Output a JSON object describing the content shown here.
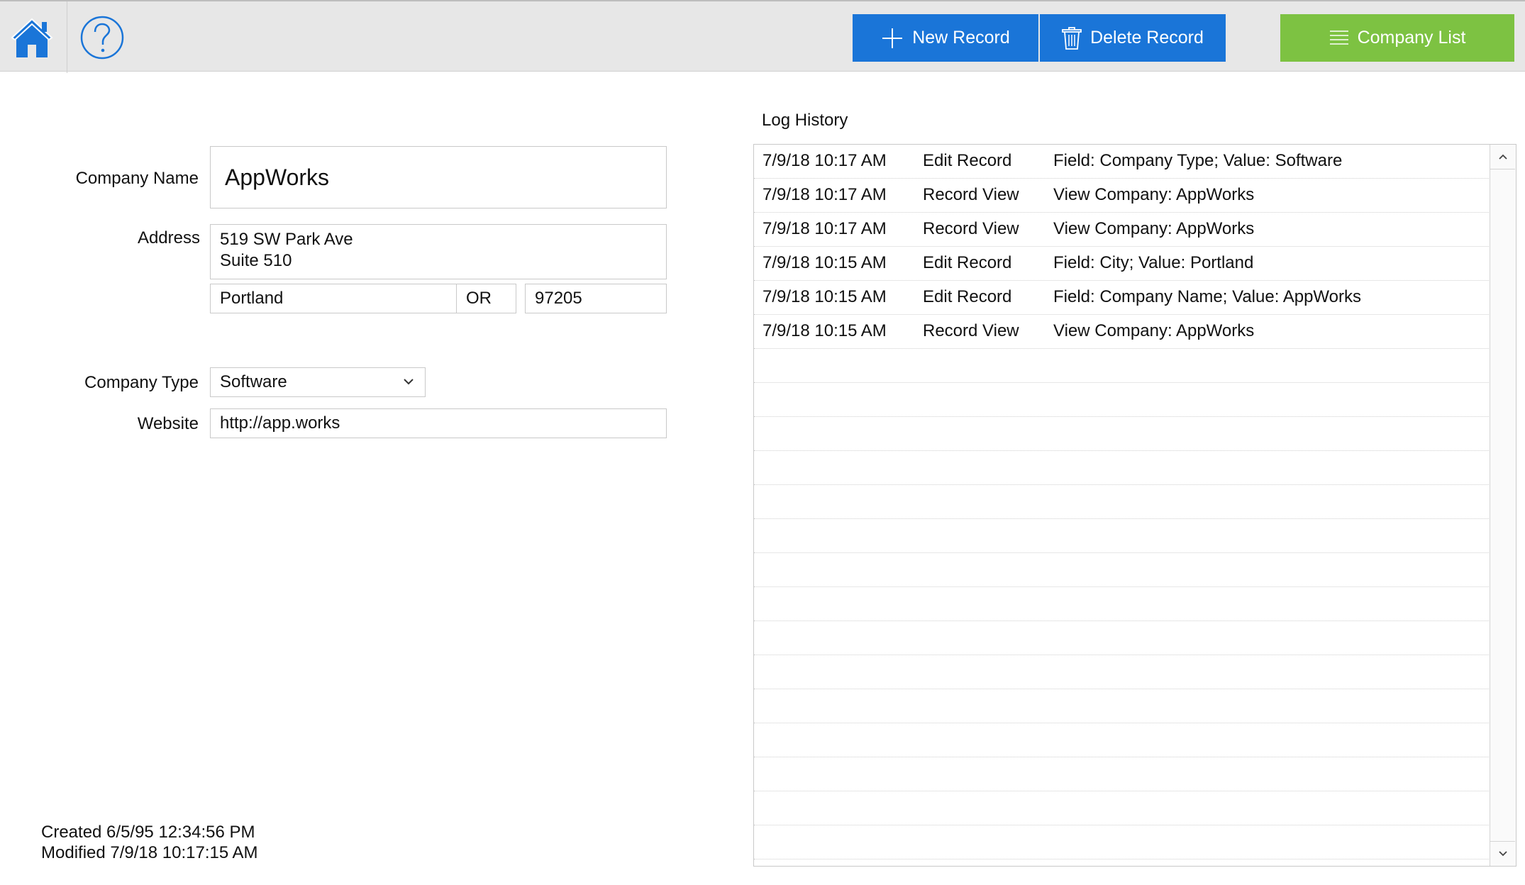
{
  "toolbar": {
    "new_record_label": "New Record",
    "delete_record_label": "Delete Record",
    "company_list_label": "Company List",
    "primary_color": "#1a75d8",
    "secondary_color": "#7dc242"
  },
  "form": {
    "company_name_label": "Company Name",
    "company_name_value": "AppWorks",
    "address_label": "Address",
    "address_line1": "519 SW Park Ave",
    "address_line2": "Suite 510",
    "city": "Portland",
    "state": "OR",
    "zip": "97205",
    "company_type_label": "Company Type",
    "company_type_value": "Software",
    "website_label": "Website",
    "website_value": "http://app.works"
  },
  "meta": {
    "created": "Created 6/5/95 12:34:56 PM",
    "modified": "Modified 7/9/18 10:17:15 AM"
  },
  "log": {
    "title": "Log History",
    "rows": [
      {
        "date": "7/9/18 10:17 AM",
        "action": "Edit Record",
        "detail": "Field: Company Type; Value: Software"
      },
      {
        "date": "7/9/18 10:17 AM",
        "action": "Record View",
        "detail": "View Company: AppWorks"
      },
      {
        "date": "7/9/18 10:17 AM",
        "action": "Record View",
        "detail": "View Company: AppWorks"
      },
      {
        "date": "7/9/18 10:15 AM",
        "action": "Edit Record",
        "detail": "Field: City; Value: Portland"
      },
      {
        "date": "7/9/18 10:15 AM",
        "action": "Edit Record",
        "detail": "Field: Company Name; Value: AppWorks"
      },
      {
        "date": "7/9/18 10:15 AM",
        "action": "Record View",
        "detail": "View Company: AppWorks"
      },
      {
        "date": "",
        "action": "",
        "detail": ""
      },
      {
        "date": "",
        "action": "",
        "detail": ""
      },
      {
        "date": "",
        "action": "",
        "detail": ""
      },
      {
        "date": "",
        "action": "",
        "detail": ""
      },
      {
        "date": "",
        "action": "",
        "detail": ""
      },
      {
        "date": "",
        "action": "",
        "detail": ""
      },
      {
        "date": "",
        "action": "",
        "detail": ""
      },
      {
        "date": "",
        "action": "",
        "detail": ""
      },
      {
        "date": "",
        "action": "",
        "detail": ""
      },
      {
        "date": "",
        "action": "",
        "detail": ""
      },
      {
        "date": "",
        "action": "",
        "detail": ""
      },
      {
        "date": "",
        "action": "",
        "detail": ""
      },
      {
        "date": "",
        "action": "",
        "detail": ""
      },
      {
        "date": "",
        "action": "",
        "detail": ""
      },
      {
        "date": "",
        "action": "",
        "detail": ""
      }
    ]
  }
}
